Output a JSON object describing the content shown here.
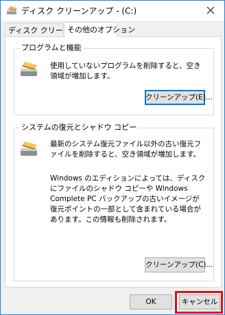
{
  "window": {
    "title": "ディスク クリーンアップ - (C:)"
  },
  "tabs": [
    {
      "label": "ディスク クリーンアップ"
    },
    {
      "label": "その他のオプション"
    }
  ],
  "programs_group": {
    "title": "プログラムと機能",
    "description": "使用していないプログラムを削除すると、空き領域が増加します。",
    "button_label": "クリーンアップ(E)..."
  },
  "restore_group": {
    "title": "システムの復元とシャドウ コピー",
    "description": "最新のシステム復元ファイル以外の古い復元ファイルを削除すると、空き領域が増加します。",
    "note": "Windows のエディションによっては、ディスクにファイルのシャドウ コピーや Windows Complete PC バックアップの古いイメージが復元ポイントの一部として含まれている場合があります。この情報も削除されます。",
    "button_label": "クリーンアップ(C)..."
  },
  "footer": {
    "ok_label": "OK",
    "cancel_label": "キャンセル"
  },
  "colors": {
    "accent": "#0078d7",
    "highlight": "#e01010"
  },
  "icons": [
    "disk-cleanup-icon",
    "close-icon",
    "programs-icon",
    "system-restore-icon"
  ]
}
